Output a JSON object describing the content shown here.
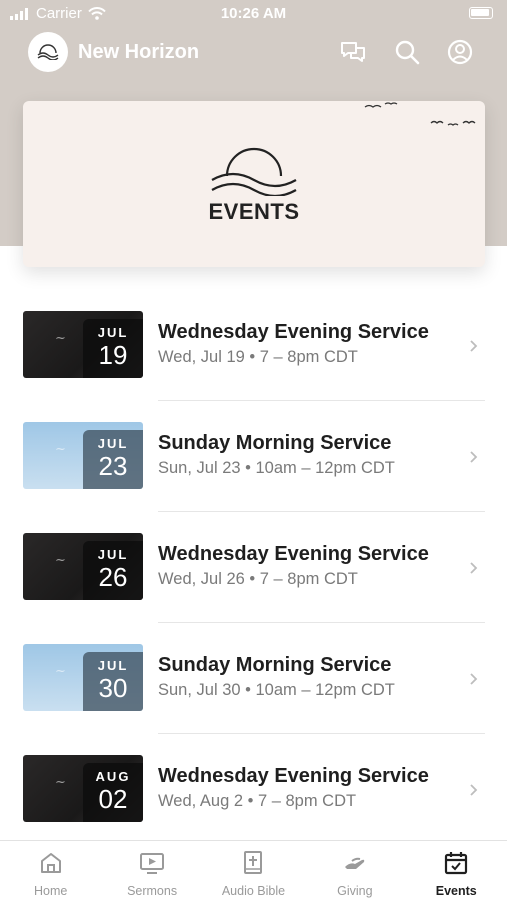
{
  "status_bar": {
    "carrier": "Carrier",
    "time": "10:26 AM"
  },
  "header": {
    "title": "New Horizon"
  },
  "banner": {
    "title": "EVENTS"
  },
  "events": [
    {
      "title": "Wednesday Evening Service",
      "subtitle": "Wed, Jul 19 • 7 – 8pm CDT",
      "month": "JUL",
      "day": "19",
      "thumb_style": "dark"
    },
    {
      "title": "Sunday Morning Service",
      "subtitle": "Sun, Jul 23 • 10am – 12pm CDT",
      "month": "JUL",
      "day": "23",
      "thumb_style": "light"
    },
    {
      "title": "Wednesday Evening Service",
      "subtitle": "Wed, Jul 26 • 7 – 8pm CDT",
      "month": "JUL",
      "day": "26",
      "thumb_style": "dark"
    },
    {
      "title": "Sunday Morning Service",
      "subtitle": "Sun, Jul 30 • 10am – 12pm CDT",
      "month": "JUL",
      "day": "30",
      "thumb_style": "light"
    },
    {
      "title": "Wednesday Evening Service",
      "subtitle": "Wed, Aug 2 • 7 – 8pm CDT",
      "month": "AUG",
      "day": "02",
      "thumb_style": "dark"
    }
  ],
  "tabs": [
    {
      "label": "Home",
      "icon": "home-icon"
    },
    {
      "label": "Sermons",
      "icon": "sermons-icon"
    },
    {
      "label": "Audio Bible",
      "icon": "bible-icon"
    },
    {
      "label": "Giving",
      "icon": "giving-icon"
    },
    {
      "label": "Events",
      "icon": "events-icon",
      "active": true
    }
  ],
  "colors": {
    "header_bg": "#d3ccc6",
    "text_primary": "#1f1f1f",
    "text_secondary": "#7a7a7a",
    "tab_inactive": "#9a9a9a"
  }
}
